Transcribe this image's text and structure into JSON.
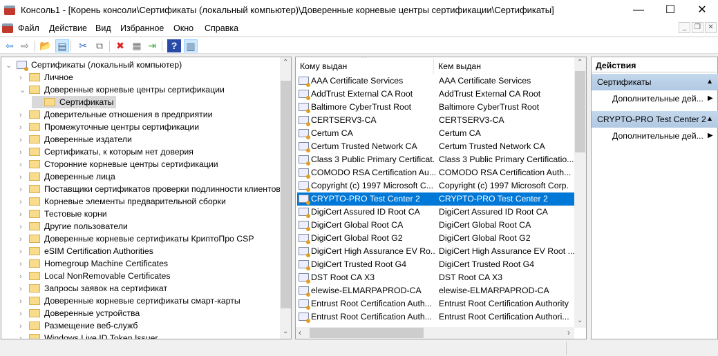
{
  "window": {
    "title": "Консоль1 - [Корень консоли\\Сертификаты (локальный компьютер)\\Доверенные корневые центры сертификации\\Сертификаты]",
    "minimize": "—",
    "maximize": "☐",
    "close": "✕"
  },
  "menu": [
    "Файл",
    "Действие",
    "Вид",
    "Избранное",
    "Окно",
    "Справка"
  ],
  "mdi": {
    "minimize": "_",
    "restore": "❐",
    "close": "✕"
  },
  "toolbar": [
    {
      "name": "back-icon",
      "glyph": "⇦",
      "color": "#2f7fd6"
    },
    {
      "name": "forward-icon",
      "glyph": "⇨",
      "color": "#777"
    },
    {
      "name": "up-folder-icon",
      "glyph": "📂",
      "color": "#c90"
    },
    {
      "name": "show-hide-tree-icon",
      "glyph": "▤",
      "color": "#468",
      "on": true
    },
    {
      "name": "cut-icon",
      "glyph": "✂",
      "color": "#36c"
    },
    {
      "name": "copy-icon",
      "glyph": "⧉",
      "color": "#777"
    },
    {
      "name": "delete-icon",
      "glyph": "✖",
      "color": "#d22"
    },
    {
      "name": "properties-icon",
      "glyph": "▦",
      "color": "#777"
    },
    {
      "name": "export-icon",
      "glyph": "⇥",
      "color": "#3a3"
    },
    {
      "name": "help-icon",
      "glyph": "?",
      "color": "#fff",
      "bg": "#2a4aa8"
    },
    {
      "name": "show-action-pane-icon",
      "glyph": "▥",
      "color": "#468",
      "on": true
    }
  ],
  "tree": {
    "root": "Сертификаты (локальный компьютер)",
    "items": [
      {
        "label": "Личное",
        "level": 1,
        "state": "collapsed"
      },
      {
        "label": "Доверенные корневые центры сертификации",
        "level": 1,
        "state": "expanded"
      },
      {
        "label": "Сертификаты",
        "level": 2,
        "state": "leaf",
        "selected": true
      },
      {
        "label": "Доверительные отношения в предприятии",
        "level": 1,
        "state": "collapsed"
      },
      {
        "label": "Промежуточные центры сертификации",
        "level": 1,
        "state": "collapsed"
      },
      {
        "label": "Доверенные издатели",
        "level": 1,
        "state": "collapsed"
      },
      {
        "label": "Сертификаты, к которым нет доверия",
        "level": 1,
        "state": "collapsed"
      },
      {
        "label": "Сторонние корневые центры сертификации",
        "level": 1,
        "state": "collapsed"
      },
      {
        "label": "Доверенные лица",
        "level": 1,
        "state": "collapsed"
      },
      {
        "label": "Поставщики сертификатов проверки подлинности клиентов",
        "level": 1,
        "state": "collapsed"
      },
      {
        "label": "Корневые элементы предварительной сборки",
        "level": 1,
        "state": "collapsed"
      },
      {
        "label": "Тестовые корни",
        "level": 1,
        "state": "collapsed"
      },
      {
        "label": "Другие пользователи",
        "level": 1,
        "state": "collapsed"
      },
      {
        "label": "Доверенные корневые сертификаты КриптоПро CSP",
        "level": 1,
        "state": "collapsed"
      },
      {
        "label": "eSIM Certification Authorities",
        "level": 1,
        "state": "collapsed"
      },
      {
        "label": "Homegroup Machine Certificates",
        "level": 1,
        "state": "collapsed"
      },
      {
        "label": "Local NonRemovable Certificates",
        "level": 1,
        "state": "collapsed"
      },
      {
        "label": "Запросы заявок на сертификат",
        "level": 1,
        "state": "collapsed"
      },
      {
        "label": "Доверенные корневые сертификаты смарт-карты",
        "level": 1,
        "state": "collapsed"
      },
      {
        "label": "Доверенные устройства",
        "level": 1,
        "state": "collapsed"
      },
      {
        "label": "Размещение веб-служб",
        "level": 1,
        "state": "collapsed"
      },
      {
        "label": "Windows Live ID Token Issuer",
        "level": 1,
        "state": "collapsed"
      }
    ]
  },
  "list": {
    "columns": [
      "Кому выдан",
      "Кем выдан"
    ],
    "sort_indicator": "^",
    "rows": [
      [
        "AAA Certificate Services",
        "AAA Certificate Services"
      ],
      [
        "AddTrust External CA Root",
        "AddTrust External CA Root"
      ],
      [
        "Baltimore CyberTrust Root",
        "Baltimore CyberTrust Root"
      ],
      [
        "CERTSERV3-CA",
        "CERTSERV3-CA"
      ],
      [
        "Certum CA",
        "Certum CA"
      ],
      [
        "Certum Trusted Network CA",
        "Certum Trusted Network CA"
      ],
      [
        "Class 3 Public Primary Certificat...",
        "Class 3 Public Primary Certificatio..."
      ],
      [
        "COMODO RSA Certification Au...",
        "COMODO RSA Certification Auth..."
      ],
      [
        "Copyright (c) 1997 Microsoft C...",
        "Copyright (c) 1997 Microsoft Corp."
      ],
      [
        "CRYPTO-PRO Test Center 2",
        "CRYPTO-PRO Test Center 2"
      ],
      [
        "DigiCert Assured ID Root CA",
        "DigiCert Assured ID Root CA"
      ],
      [
        "DigiCert Global Root CA",
        "DigiCert Global Root CA"
      ],
      [
        "DigiCert Global Root G2",
        "DigiCert Global Root G2"
      ],
      [
        "DigiCert High Assurance EV Ro...",
        "DigiCert High Assurance EV Root ..."
      ],
      [
        "DigiCert Trusted Root G4",
        "DigiCert Trusted Root G4"
      ],
      [
        "DST Root CA X3",
        "DST Root CA X3"
      ],
      [
        "elewise-ELMARPAPROD-CA",
        "elewise-ELMARPAPROD-CA"
      ],
      [
        "Entrust Root Certification Auth...",
        "Entrust Root Certification Authority"
      ],
      [
        "Entrust Root Certification Auth...",
        "Entrust Root Certification Authori..."
      ]
    ],
    "selected_index": 9
  },
  "actions": {
    "title": "Действия",
    "sections": [
      {
        "label": "Сертификаты",
        "item": "Дополнительные дей..."
      },
      {
        "label": "CRYPTO-PRO Test Center 2",
        "item": "Дополнительные дей..."
      }
    ]
  }
}
